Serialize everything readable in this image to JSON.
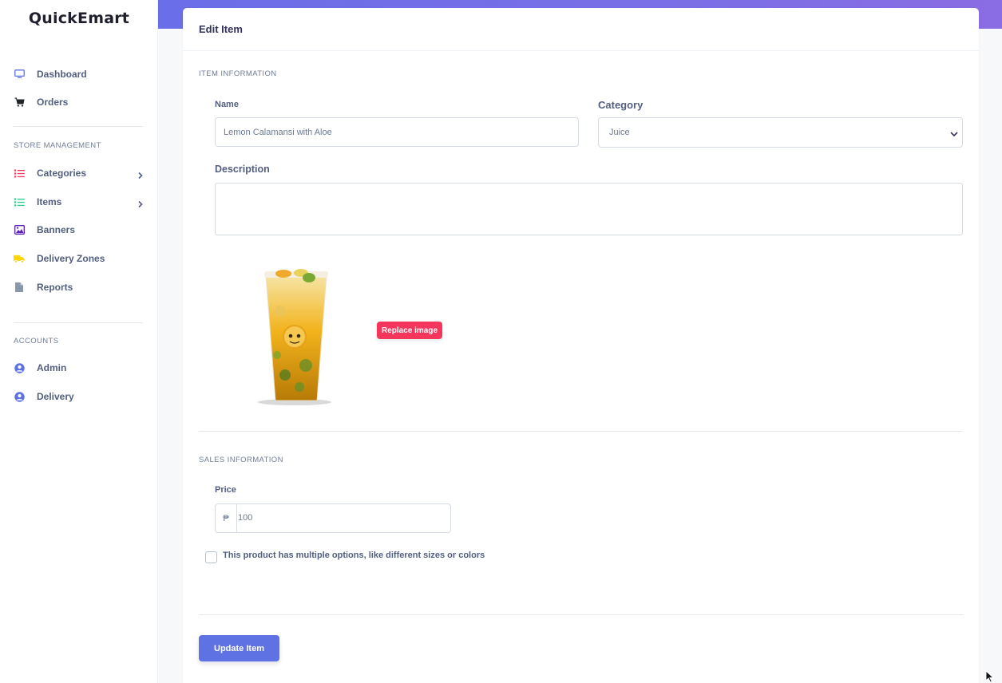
{
  "app": {
    "brand": "QuickEmart"
  },
  "sidebar": {
    "items": [
      {
        "label": "Dashboard",
        "icon": "monitor-icon",
        "color": "#5e72e4"
      },
      {
        "label": "Orders",
        "icon": "cart-icon",
        "color": "#212529"
      }
    ],
    "store_heading": "STORE MANAGEMENT",
    "store_items": [
      {
        "label": "Categories",
        "icon": "list-icon",
        "color": "#f5365c"
      },
      {
        "label": "Items",
        "icon": "list-icon",
        "color": "#2dce89"
      },
      {
        "label": "Banners",
        "icon": "image-icon",
        "color": "#5b21b6"
      },
      {
        "label": "Delivery Zones",
        "icon": "truck-icon",
        "color": "#ffd600"
      },
      {
        "label": "Reports",
        "icon": "file-icon",
        "color": "#8898aa"
      }
    ],
    "accounts_heading": "ACCOUNTS",
    "account_items": [
      {
        "label": "Admin",
        "icon": "user-icon",
        "color": "#5e72e4"
      },
      {
        "label": "Delivery",
        "icon": "user-icon",
        "color": "#5e72e4"
      }
    ]
  },
  "card": {
    "title": "Edit Item"
  },
  "item_info": {
    "section_title": "ITEM INFORMATION",
    "name_label": "Name",
    "name_value": "Lemon Calamansi with Aloe",
    "category_label": "Category",
    "category_value": "Juice",
    "description_label": "Description",
    "description_value": "",
    "replace_image_label": "Replace image"
  },
  "sales_info": {
    "section_title": "SALES INFORMATION",
    "price_label": "Price",
    "currency_symbol": "₱",
    "price_value": "100",
    "multiple_options_label": "This product has multiple options, like different sizes or colors",
    "multiple_options_checked": false
  },
  "actions": {
    "update_label": "Update Item"
  },
  "colors": {
    "accent": "#5e72e4",
    "danger": "#f5365c",
    "header_gradient_start": "#6a6ee8",
    "header_gradient_end": "#8a6ce4"
  }
}
